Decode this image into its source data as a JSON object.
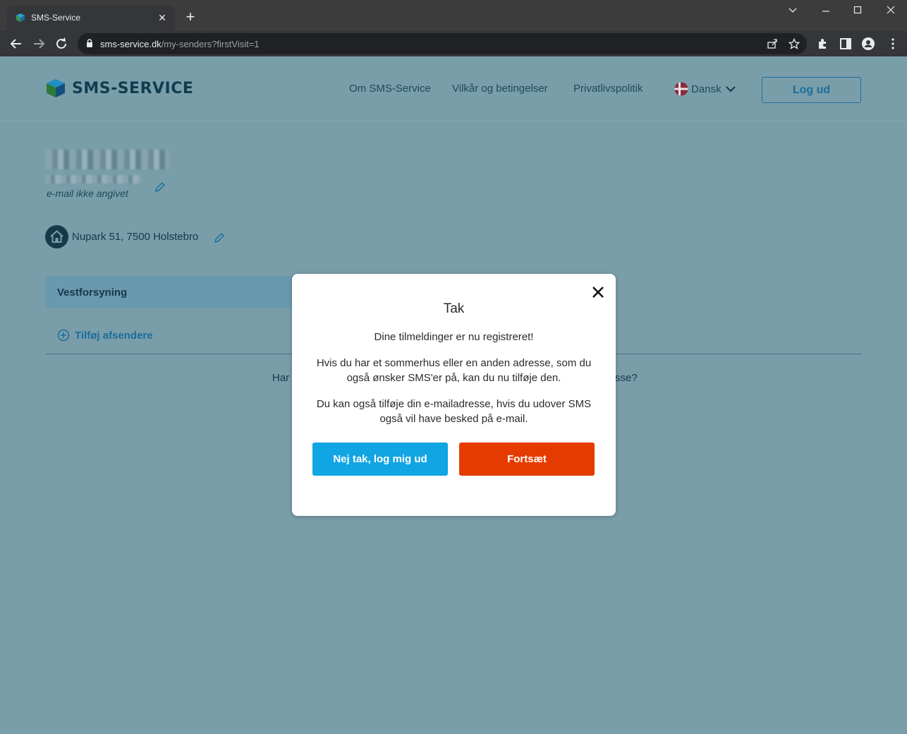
{
  "browser": {
    "tab_title": "SMS-Service",
    "url_host": "sms-service.dk",
    "url_path": "/my-senders?firstVisit=1"
  },
  "header": {
    "logo_text": "SMS-SERVICE",
    "nav": [
      "Om SMS-Service",
      "Vilkår og betingelser",
      "Privatlivspolitik"
    ],
    "language": "Dansk",
    "logout_label": "Log ud"
  },
  "profile": {
    "email": "e-mail ikke angivet",
    "address": "Nupark 51, 7500 Holstebro"
  },
  "senders": {
    "items": [
      "Vestforsyning"
    ],
    "add_label": "Tilføj afsendere",
    "bottom_text_left": "Har",
    "bottom_text_right": "sse?"
  },
  "modal": {
    "title": "Tak",
    "line1": "Dine tilmeldinger er nu registreret!",
    "line2": "Hvis du har et sommerhus eller en anden adresse, som du også ønsker SMS'er på, kan du nu tilføje den.",
    "line3": "Du kan også tilføje din e-mailadresse, hvis du udover SMS også vil have besked på e-mail.",
    "btn_no": "Nej tak, log mig ud",
    "btn_continue": "Fortsæt"
  },
  "colors": {
    "overlay": "#7a9daa",
    "primary_blue": "#11a5e3",
    "continue_orange": "#e63b00"
  }
}
